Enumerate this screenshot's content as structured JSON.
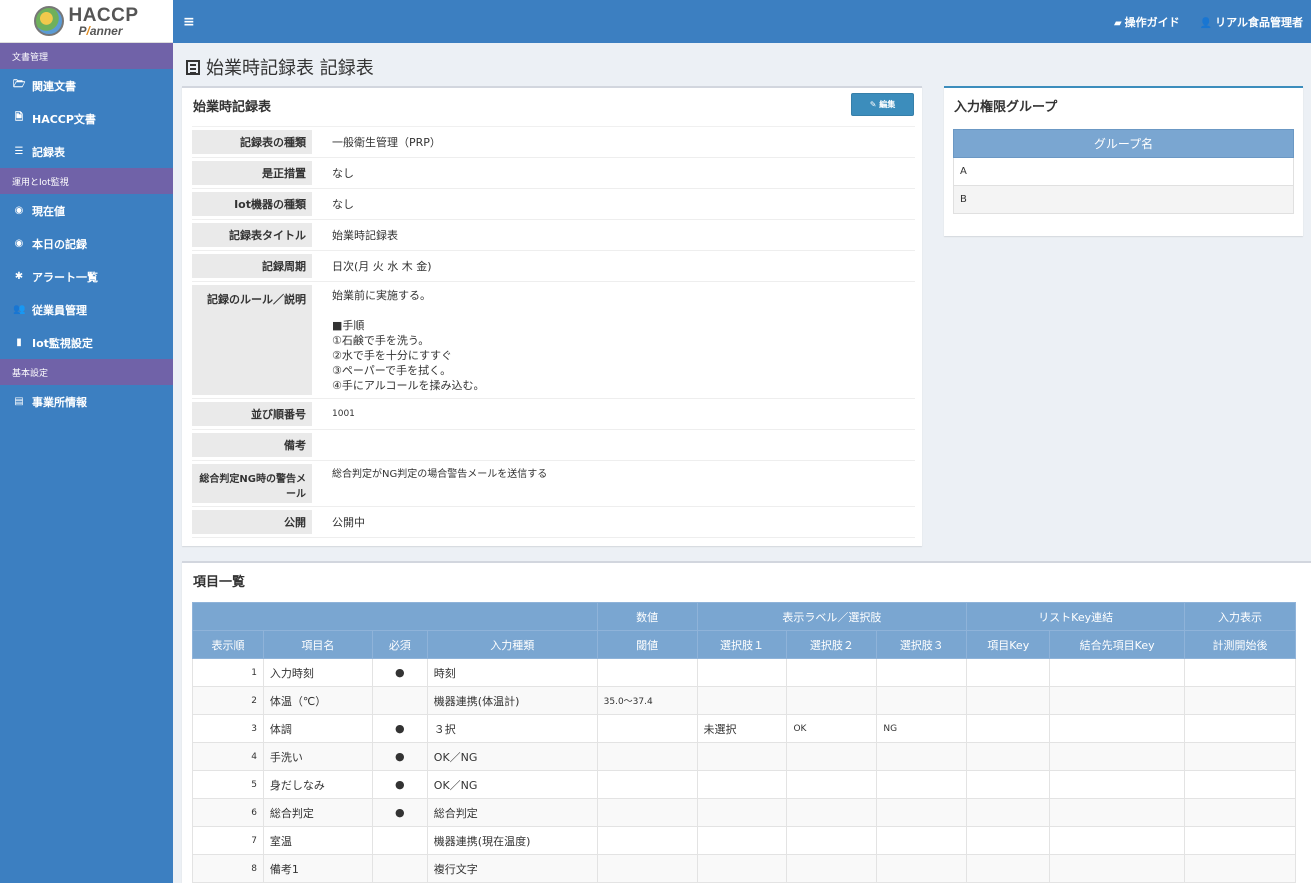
{
  "logo": {
    "line1": "HACCP",
    "line2_a": "P",
    "line2_slash": "/",
    "line2_b": "anner"
  },
  "sidebar": {
    "sections": [
      {
        "header": "文書管理",
        "items": [
          {
            "icon": "folder-open-icon",
            "glyph": "🗁",
            "label": "関連文書"
          },
          {
            "icon": "file-icon",
            "glyph": "🗎",
            "label": "HACCP文書"
          },
          {
            "icon": "list-icon",
            "glyph": "☰",
            "label": "記録表"
          }
        ]
      },
      {
        "header": "運用とIot監視",
        "items": [
          {
            "icon": "eye-icon",
            "glyph": "◉",
            "label": "現在値"
          },
          {
            "icon": "eye-icon",
            "glyph": "◉",
            "label": "本日の記録"
          },
          {
            "icon": "gear-icon",
            "glyph": "✱",
            "label": "アラート一覧"
          },
          {
            "icon": "users-icon",
            "glyph": "👥",
            "label": "従業員管理"
          },
          {
            "icon": "bar-chart-icon",
            "glyph": "▮",
            "label": "Iot監視設定"
          }
        ]
      },
      {
        "header": "基本設定",
        "items": [
          {
            "icon": "building-icon",
            "glyph": "▤",
            "label": "事業所情報"
          }
        ]
      }
    ]
  },
  "topbar": {
    "menu_glyph": "≡",
    "guide_label": "操作ガイド",
    "user_label": "リアル食品管理者"
  },
  "page": {
    "title": "始業時記録表 記録表"
  },
  "detail": {
    "title": "始業時記録表",
    "edit_label": "編集",
    "rows": [
      {
        "label": "記録表の種類",
        "value": "一般衛生管理（PRP）"
      },
      {
        "label": "是正措置",
        "value": "なし"
      },
      {
        "label": "Iot機器の種類",
        "value": "なし"
      },
      {
        "label": "記録表タイトル",
        "value": "始業時記録表"
      },
      {
        "label": "記録周期",
        "value": "日次(月 火 水 木 金)"
      },
      {
        "label": "記録のルール／説明",
        "value": "始業前に実施する。\n\n■手順\n①石鹸で手を洗う。\n②水で手を十分にすすぐ\n③ペーパーで手を拭く。\n④手にアルコールを揉み込む。"
      },
      {
        "label": "並び順番号",
        "value": "1001"
      },
      {
        "label": "備考",
        "value": ""
      },
      {
        "label": "総合判定NG時の警告メール",
        "value": "総合判定がNG判定の場合警告メールを送信する"
      },
      {
        "label": "公開",
        "value": "公開中"
      }
    ]
  },
  "perm": {
    "title": "入力権限グループ",
    "header": "グループ名",
    "rows": [
      "A",
      "B"
    ]
  },
  "items": {
    "title": "項目一覧",
    "group_headers": [
      "数値",
      "表示ラベル／選択肢",
      "リストKey連結",
      "入力表示"
    ],
    "headers": [
      "表示順",
      "項目名",
      "必須",
      "入力種類",
      "閾値",
      "選択肢１",
      "選択肢２",
      "選択肢３",
      "項目Key",
      "結合先項目Key",
      "計測開始後"
    ],
    "rows": [
      {
        "order": "1",
        "name": "入力時刻",
        "required": "●",
        "type": "時刻",
        "threshold": "",
        "c1": "",
        "c2": "",
        "c3": ""
      },
      {
        "order": "2",
        "name": "体温（℃）",
        "required": "",
        "type": "機器連携(体温計)",
        "threshold": "35.0～37.4",
        "c1": "",
        "c2": "",
        "c3": ""
      },
      {
        "order": "3",
        "name": "体調",
        "required": "●",
        "type": "３択",
        "threshold": "",
        "c1": "未選択",
        "c2": "OK",
        "c3": "NG"
      },
      {
        "order": "4",
        "name": "手洗い",
        "required": "●",
        "type": "OK／NG",
        "threshold": "",
        "c1": "",
        "c2": "",
        "c3": ""
      },
      {
        "order": "5",
        "name": "身だしなみ",
        "required": "●",
        "type": "OK／NG",
        "threshold": "",
        "c1": "",
        "c2": "",
        "c3": ""
      },
      {
        "order": "6",
        "name": "総合判定",
        "required": "●",
        "type": "総合判定",
        "threshold": "",
        "c1": "",
        "c2": "",
        "c3": ""
      },
      {
        "order": "7",
        "name": "室温",
        "required": "",
        "type": "機器連携(現在温度)",
        "threshold": "",
        "c1": "",
        "c2": "",
        "c3": ""
      },
      {
        "order": "8",
        "name": "備考1",
        "required": "",
        "type": "複行文字",
        "threshold": "",
        "c1": "",
        "c2": "",
        "c3": ""
      }
    ]
  }
}
